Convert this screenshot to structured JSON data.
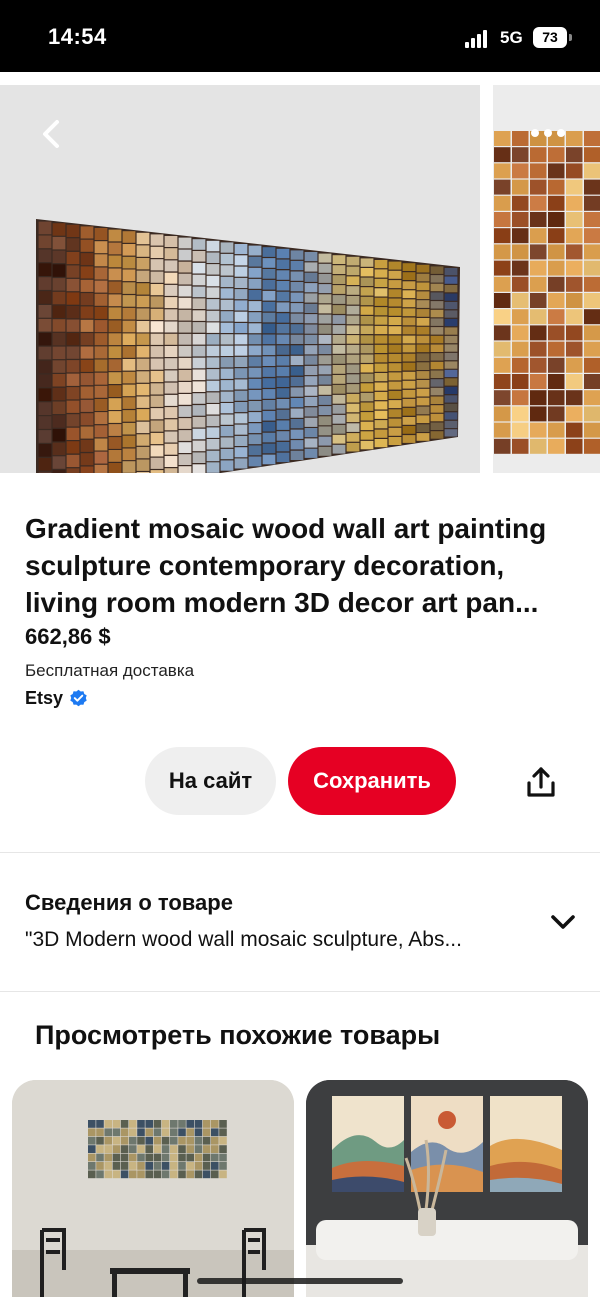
{
  "status_bar": {
    "time": "14:54",
    "network": "5G",
    "battery": "73"
  },
  "product": {
    "title": "Gradient mosaic wood wall art painting sculpture contemporary decoration, living room modern 3D decor art pan...",
    "price": "662,86 $",
    "shipping": "Бесплатная доставка",
    "seller": "Etsy"
  },
  "actions": {
    "visit_label": "На сайт",
    "save_label": "Сохранить"
  },
  "details": {
    "title": "Сведения о товаре",
    "description": "\"3D Modern wood wall mosaic sculpture, Abs..."
  },
  "similar": {
    "title": "Просмотреть похожие товары"
  },
  "icons": {
    "back": "chevron-left-icon",
    "more": "more-dots-icon",
    "share": "share-icon",
    "expand": "chevron-down-icon",
    "verified": "verified-check-icon",
    "signal": "signal-bars-icon"
  },
  "colors": {
    "save_button": "#e60023",
    "visit_button": "#efefef",
    "verified": "#1d7af2"
  }
}
